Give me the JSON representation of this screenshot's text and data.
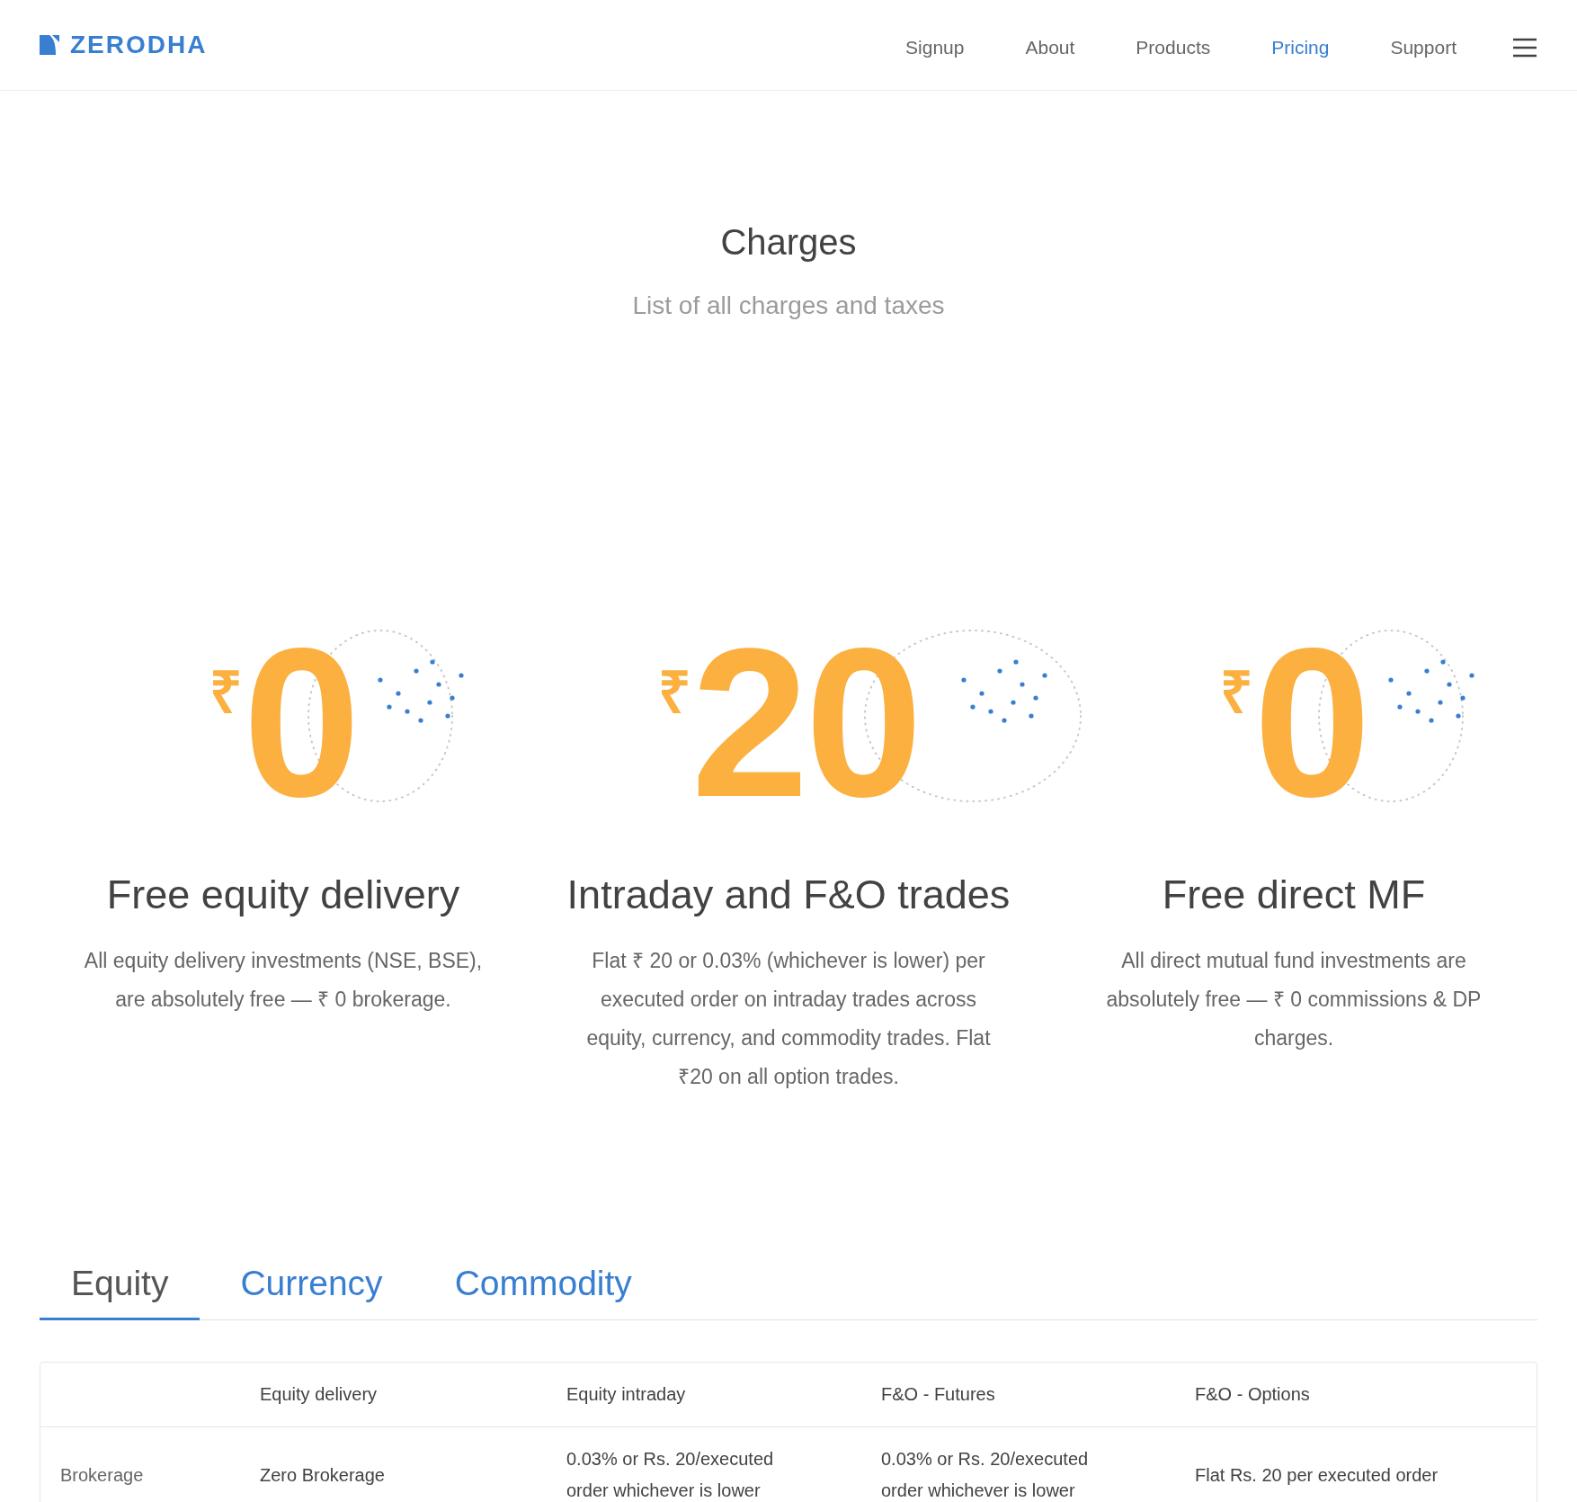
{
  "header": {
    "logo": "ZERODHA",
    "nav": [
      {
        "label": "Signup",
        "selected": false
      },
      {
        "label": "About",
        "selected": false
      },
      {
        "label": "Products",
        "selected": false
      },
      {
        "label": "Pricing",
        "selected": true
      },
      {
        "label": "Support",
        "selected": false
      }
    ]
  },
  "hero": {
    "title": "Charges",
    "subtitle": "List of all charges and taxes"
  },
  "features": [
    {
      "currency": "₹",
      "amount": "0",
      "title": "Free equity delivery",
      "text": "All equity delivery investments (NSE, BSE), are absolutely free — ₹ 0 brokerage."
    },
    {
      "currency": "₹",
      "amount": "20",
      "title": "Intraday and F&O trades",
      "text": "Flat ₹ 20 or 0.03% (whichever is lower) per executed order on intraday trades across equity, currency, and commodity trades. Flat ₹20 on all option trades."
    },
    {
      "currency": "₹",
      "amount": "0",
      "title": "Free direct MF",
      "text": "All direct mutual fund investments are absolutely free — ₹ 0 commissions & DP charges."
    }
  ],
  "tabs": [
    {
      "label": "Equity",
      "selected": true
    },
    {
      "label": "Currency",
      "selected": false
    },
    {
      "label": "Commodity",
      "selected": false
    }
  ],
  "table": {
    "columns": [
      "Equity delivery",
      "Equity intraday",
      "F&O - Futures",
      "F&O - Options"
    ],
    "rows": [
      {
        "label": "Brokerage",
        "cells": [
          "Zero Brokerage",
          "0.03% or Rs. 20/executed order whichever is lower",
          "0.03% or Rs. 20/executed order whichever is lower",
          "Flat Rs. 20 per executed order"
        ]
      }
    ]
  }
}
